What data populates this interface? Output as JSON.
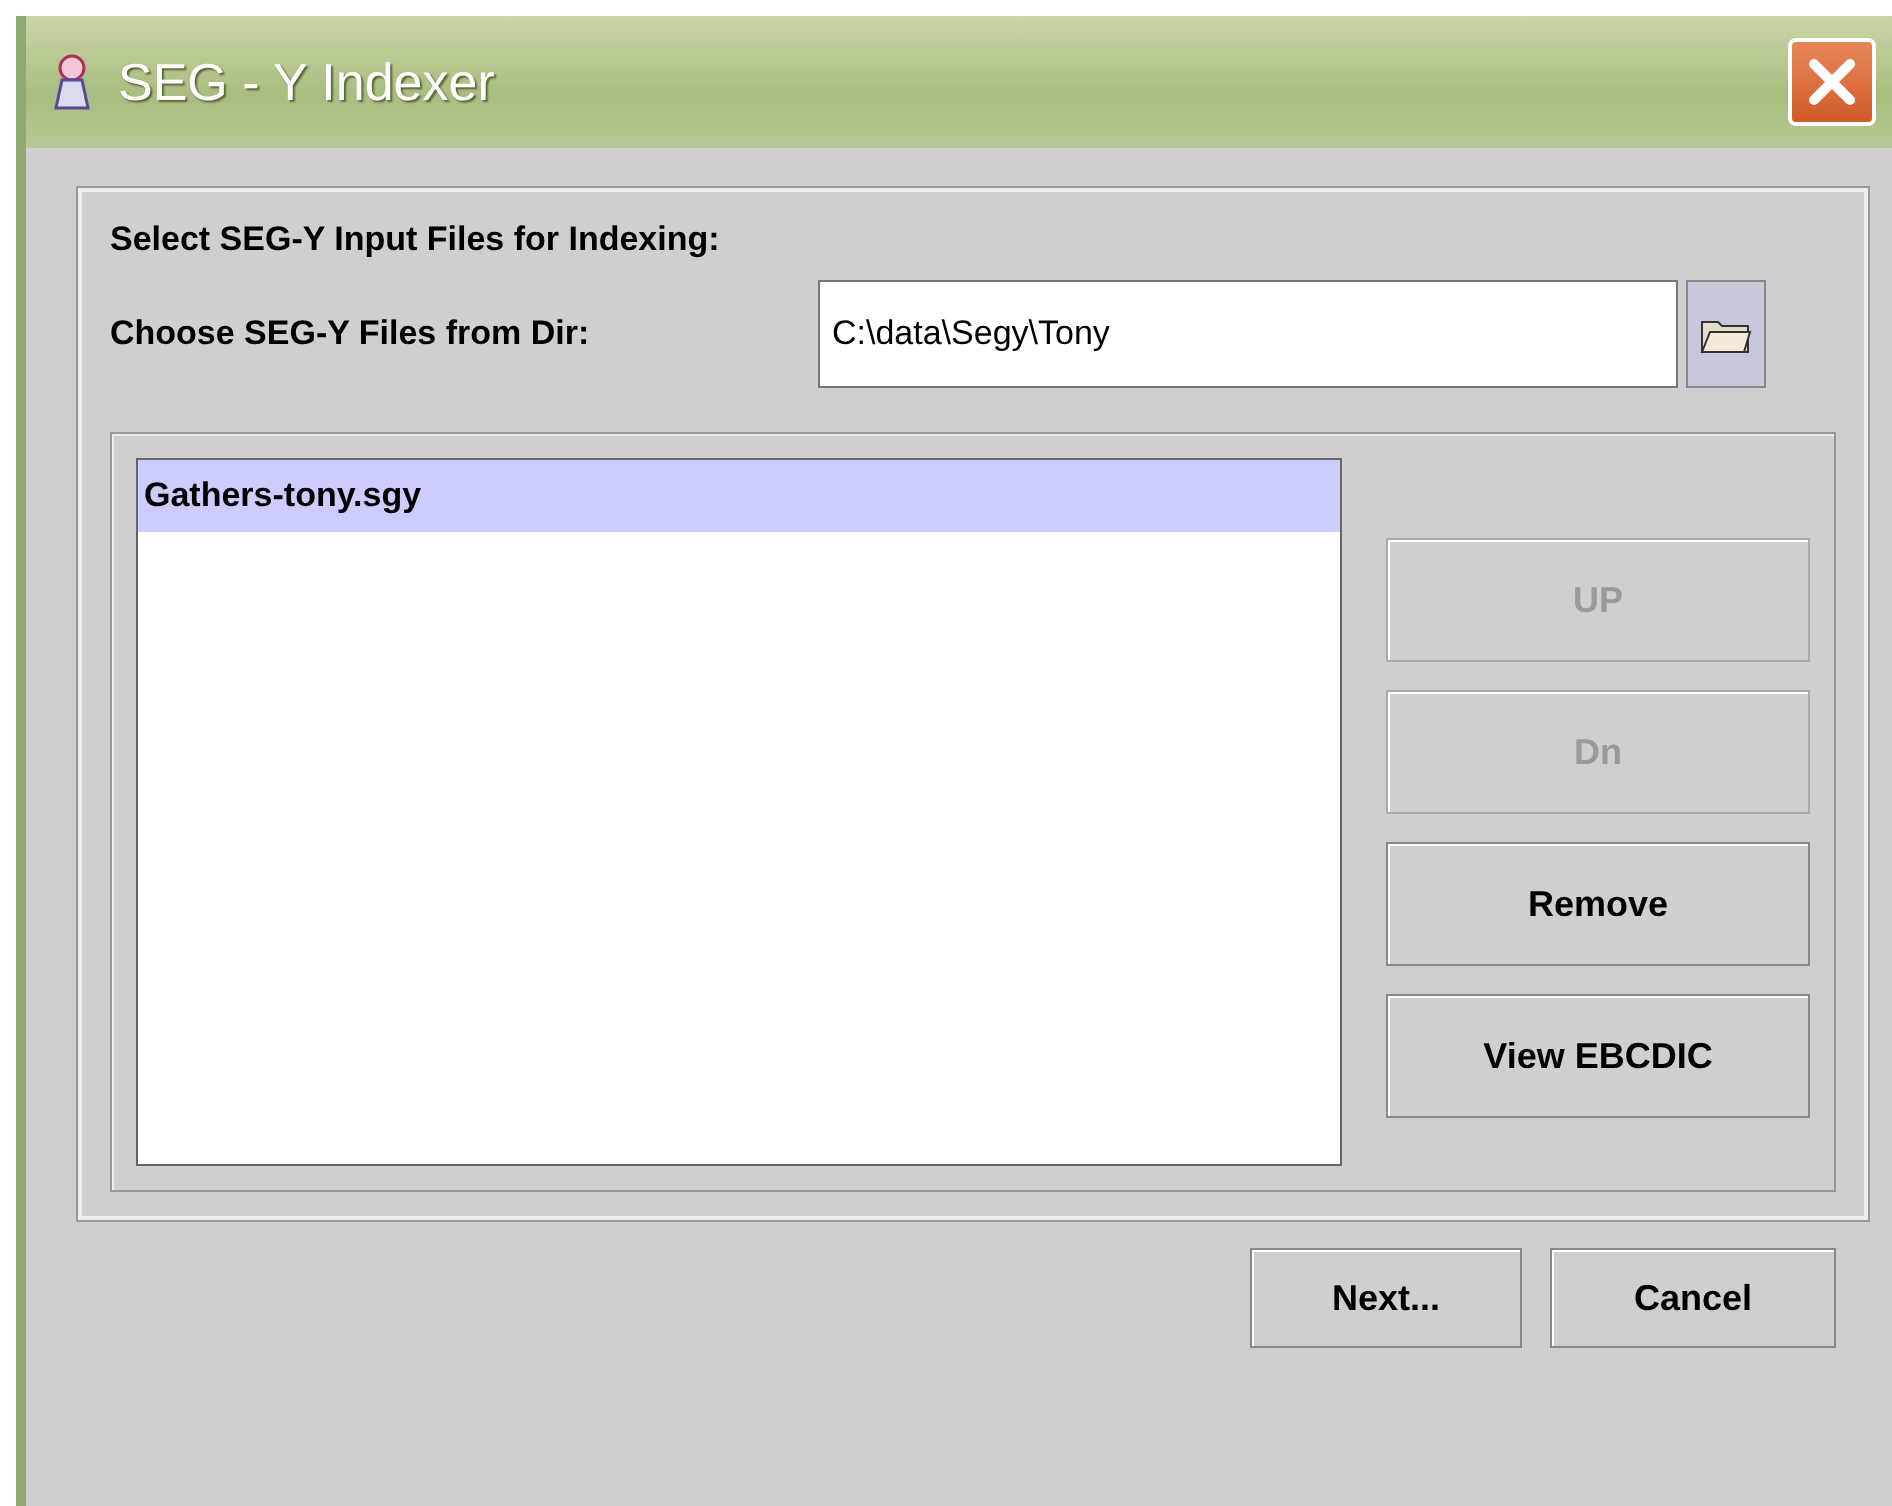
{
  "window": {
    "title": "SEG - Y  Indexer"
  },
  "heading": "Select  SEG-Y  Input  Files  for  Indexing:",
  "directory": {
    "label": "Choose SEG-Y Files from Dir:",
    "value": "C:\\data\\Segy\\Tony"
  },
  "files": [
    {
      "name": "Gathers-tony.sgy",
      "selected": true
    }
  ],
  "side_buttons": [
    {
      "label": "UP",
      "disabled": true
    },
    {
      "label": "Dn",
      "disabled": true
    },
    {
      "label": "Remove",
      "disabled": false
    },
    {
      "label": "View EBCDIC",
      "disabled": false
    }
  ],
  "buttons": [
    "Next...",
    "Cancel"
  ]
}
